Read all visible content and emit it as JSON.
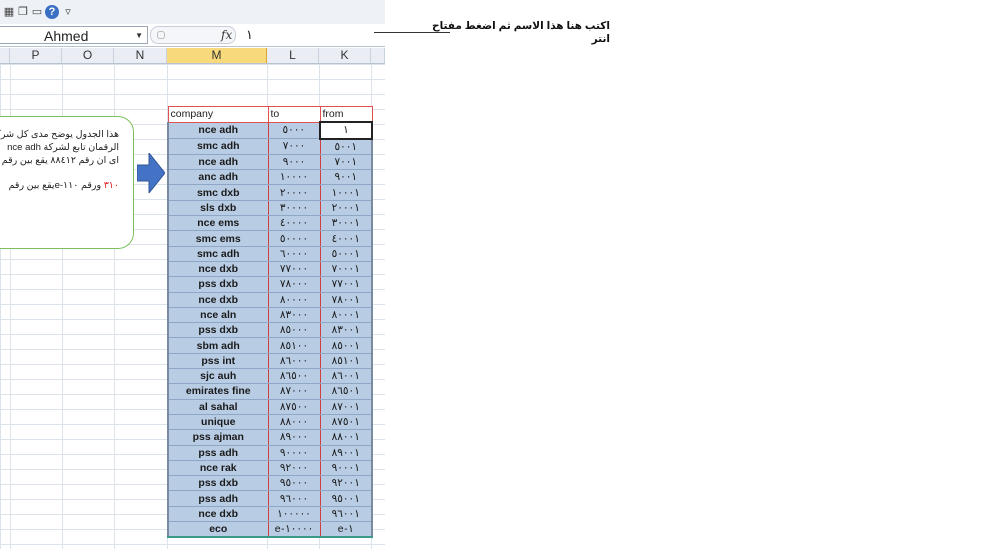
{
  "name_box": {
    "value": "Ahmed"
  },
  "formula": {
    "fx_label": "fx",
    "value": "١"
  },
  "columns": [
    "P",
    "O",
    "N",
    "M",
    "L",
    "K"
  ],
  "table": {
    "headers": {
      "company": "company",
      "to": "to",
      "from": "from"
    },
    "rows": [
      {
        "company": "nce adh",
        "to": "٥٠٠٠",
        "from": "١"
      },
      {
        "company": "smc adh",
        "to": "٧٠٠٠",
        "from": "٥٠٠١"
      },
      {
        "company": "nce adh",
        "to": "٩٠٠٠",
        "from": "٧٠٠١"
      },
      {
        "company": "anc adh",
        "to": "١٠٠٠٠",
        "from": "٩٠٠١"
      },
      {
        "company": "smc dxb",
        "to": "٢٠٠٠٠",
        "from": "١٠٠٠١"
      },
      {
        "company": "sls dxb",
        "to": "٣٠٠٠٠",
        "from": "٢٠٠٠١"
      },
      {
        "company": "nce ems",
        "to": "٤٠٠٠٠",
        "from": "٣٠٠٠١"
      },
      {
        "company": "smc ems",
        "to": "٥٠٠٠٠",
        "from": "٤٠٠٠١"
      },
      {
        "company": "smc adh",
        "to": "٦٠٠٠٠",
        "from": "٥٠٠٠١"
      },
      {
        "company": "nce dxb",
        "to": "٧٧٠٠٠",
        "from": "٧٠٠٠١"
      },
      {
        "company": "pss dxb",
        "to": "٧٨٠٠٠",
        "from": "٧٧٠٠١"
      },
      {
        "company": "nce dxb",
        "to": "٨٠٠٠٠",
        "from": "٧٨٠٠١"
      },
      {
        "company": "nce aln",
        "to": "٨٣٠٠٠",
        "from": "٨٠٠٠١"
      },
      {
        "company": "pss dxb",
        "to": "٨٥٠٠٠",
        "from": "٨٣٠٠١"
      },
      {
        "company": "sbm adh",
        "to": "٨٥١٠٠",
        "from": "٨٥٠٠١"
      },
      {
        "company": "pss int",
        "to": "٨٦٠٠٠",
        "from": "٨٥١٠١"
      },
      {
        "company": "sjc auh",
        "to": "٨٦٥٠٠",
        "from": "٨٦٠٠١"
      },
      {
        "company": "emirates fine",
        "to": "٨٧٠٠٠",
        "from": "٨٦٥٠١"
      },
      {
        "company": "al sahal",
        "to": "٨٧٥٠٠",
        "from": "٨٧٠٠١"
      },
      {
        "company": "unique",
        "to": "٨٨٠٠٠",
        "from": "٨٧٥٠١"
      },
      {
        "company": "pss ajman",
        "to": "٨٩٠٠٠",
        "from": "٨٨٠٠١"
      },
      {
        "company": "pss adh",
        "to": "٩٠٠٠٠",
        "from": "٨٩٠٠١"
      },
      {
        "company": "nce rak",
        "to": "٩٢٠٠٠",
        "from": "٩٠٠٠١"
      },
      {
        "company": "pss dxb",
        "to": "٩٥٠٠٠",
        "from": "٩٢٠٠١"
      },
      {
        "company": "pss adh",
        "to": "٩٦٠٠٠",
        "from": "٩٥٠٠١"
      },
      {
        "company": "nce dxb",
        "to": "١٠٠٠٠٠",
        "from": "٩٦٠٠١"
      },
      {
        "company": "eco",
        "to": "e-١٠٠٠٠",
        "from": "e-١"
      }
    ]
  },
  "callout": {
    "line1": "هذا الجدول يوضح مدى كل شركة",
    "line2": "الرقمان تابع لشركة   nce adh",
    "line3": "اى ان رقم ٨٨٤١٢ يقع بين رقم",
    "line4": "ورقم ١١٠-eيقع بين رقم",
    "line4_red": "٣١٠"
  },
  "note": {
    "line1": "اكتب هنا هذا الاسم ثم اضغط مفتاح",
    "line2": "انتر"
  },
  "colors": {
    "selected_column": "#f8d97c",
    "table_fill": "#b8cce4",
    "arrow": "#4472c4",
    "callout_border": "#7fbf5f",
    "header_border": "#e05050"
  }
}
